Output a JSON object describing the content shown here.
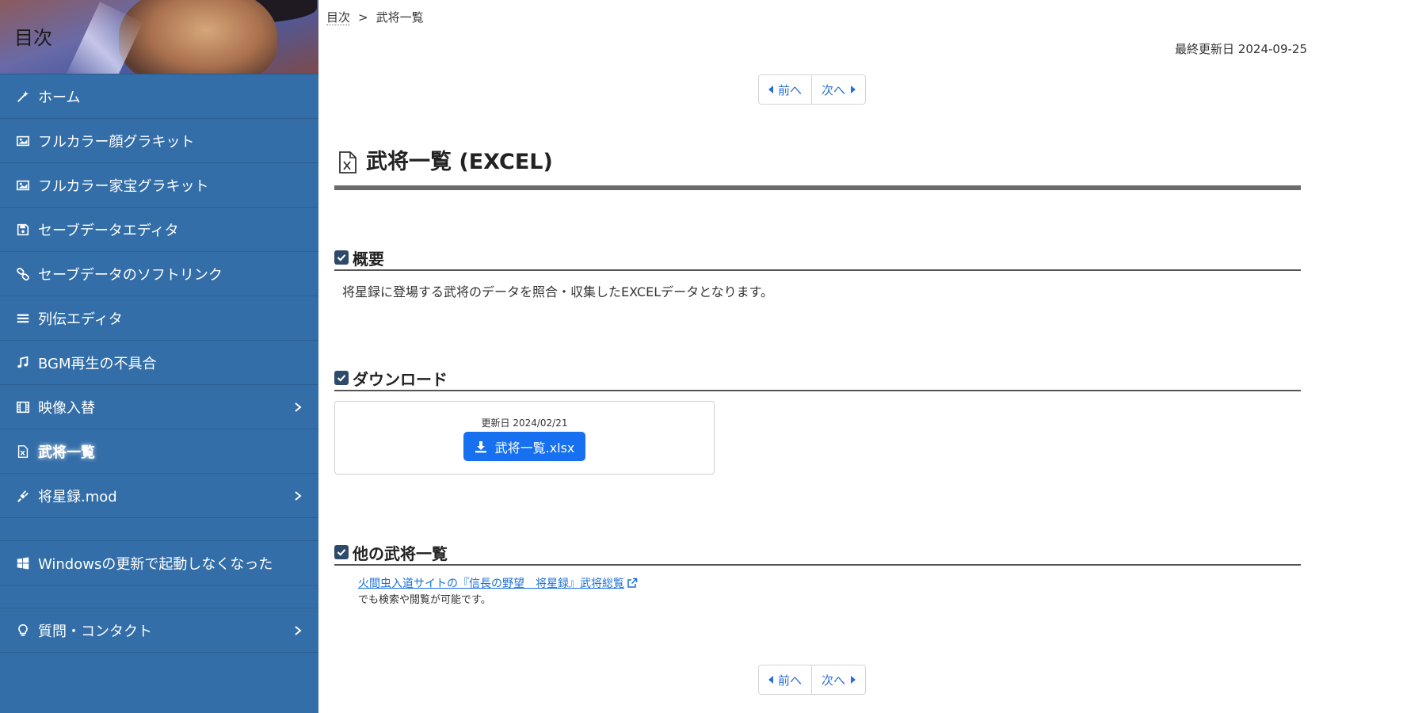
{
  "sidebar": {
    "title": "目次",
    "items": [
      {
        "label": "ホーム",
        "icon": "magic-wand-icon"
      },
      {
        "label": "フルカラー顔グラキット",
        "icon": "image-icon"
      },
      {
        "label": "フルカラー家宝グラキット",
        "icon": "image-icon"
      },
      {
        "label": "セーブデータエディタ",
        "icon": "floppy-disk-icon"
      },
      {
        "label": "セーブデータのソフトリンク",
        "icon": "link-icon"
      },
      {
        "label": "列伝エディタ",
        "icon": "list-icon"
      },
      {
        "label": "BGM再生の不具合",
        "icon": "music-note-icon"
      },
      {
        "label": "映像入替",
        "icon": "film-icon"
      },
      {
        "label": "武将一覧",
        "icon": "excel-file-icon"
      },
      {
        "label": "将星録.mod",
        "icon": "plug-icon"
      },
      {
        "label": "Windowsの更新で起動しなくなった",
        "icon": "windows-icon"
      },
      {
        "label": "質問・コンタクト",
        "icon": "lightbulb-icon"
      }
    ]
  },
  "breadcrumb": {
    "home": "目次",
    "separator": ">",
    "current": "武将一覧"
  },
  "last_updated": "最終更新日 2024-09-25",
  "pager": {
    "prev": "前へ",
    "next": "次へ"
  },
  "page_title": "武将一覧 (EXCEL)",
  "sections": {
    "overview": {
      "title": "概要",
      "text": "将星録に登場する武将のデータを照合・収集したEXCELデータとなります。"
    },
    "download": {
      "title": "ダウンロード",
      "date": "更新日 2024/02/21",
      "button": "武将一覧.xlsx"
    },
    "other": {
      "title": "他の武将一覧",
      "link": "火間虫入道サイトの『信長の野望　将星録』武将総覧",
      "text": "でも検索や閲覧が可能です。"
    }
  },
  "colors": {
    "sidebar": "#336ea8",
    "accent": "#1670f0",
    "link": "#1a6fd8"
  }
}
